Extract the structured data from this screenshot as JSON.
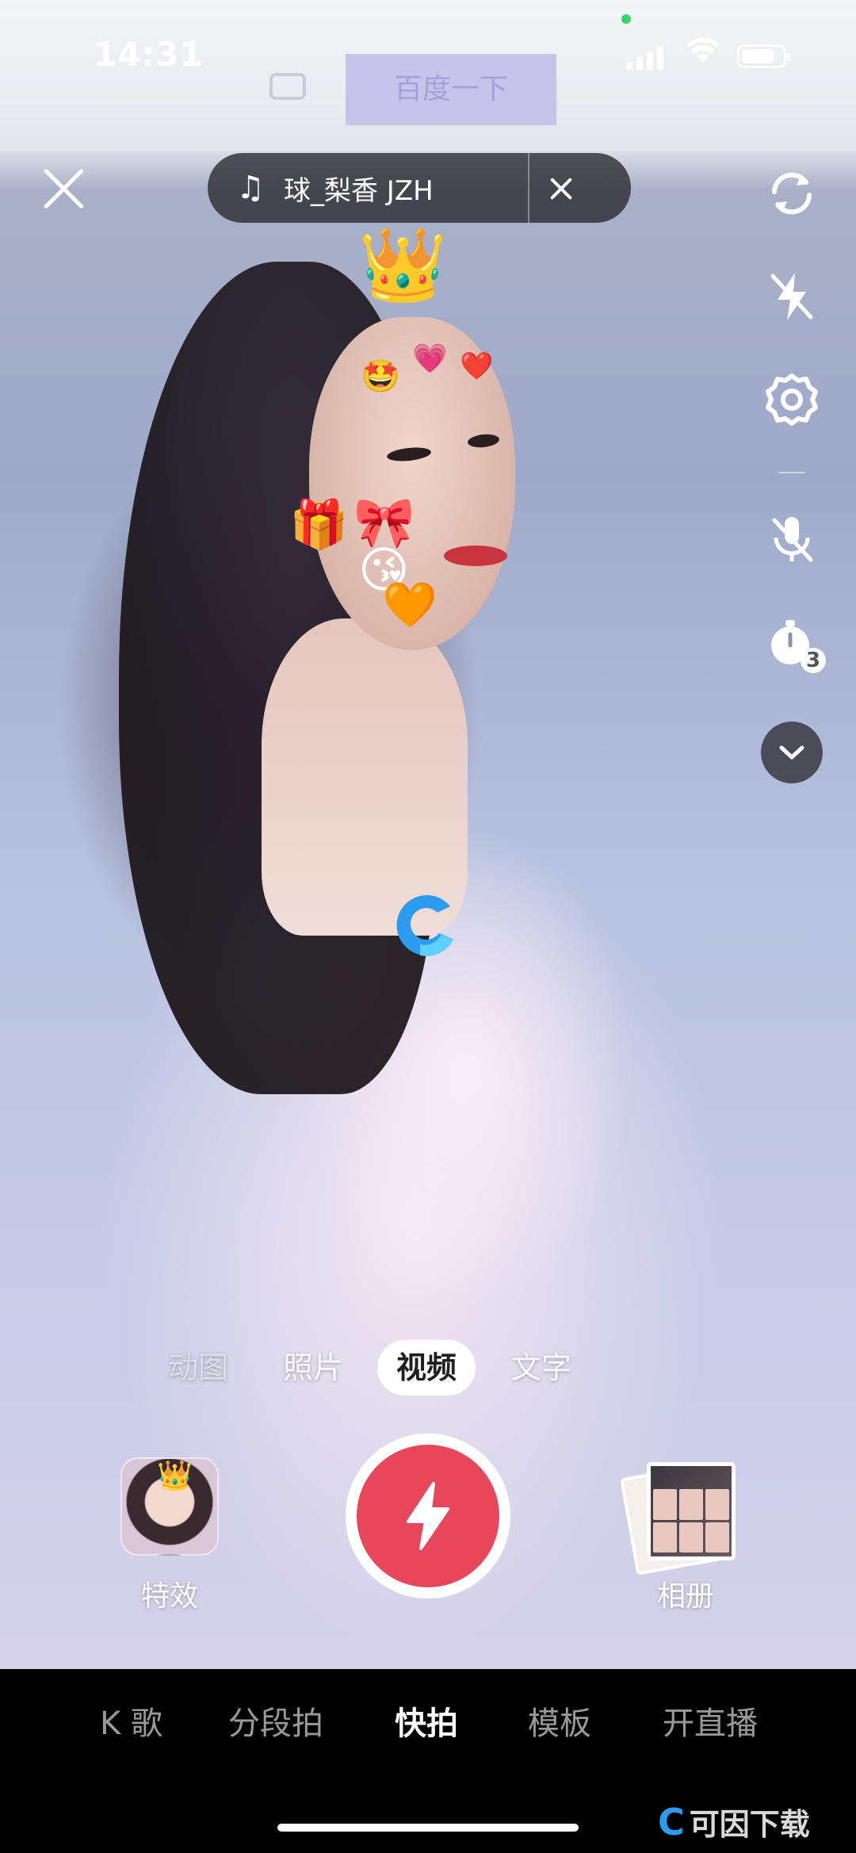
{
  "status_bar": {
    "time": "14:31"
  },
  "background_screen": {
    "search_button": "百度一下"
  },
  "music": {
    "title": "球_梨香 JZH"
  },
  "modes": [
    {
      "label": "动图"
    },
    {
      "label": "照片"
    },
    {
      "label": "视频"
    },
    {
      "label": "文字"
    }
  ],
  "active_mode": "视频",
  "capture": {
    "effects_label": "特效",
    "album_label": "相册"
  },
  "bottom_nav": [
    {
      "label": "K 歌"
    },
    {
      "label": "分段拍"
    },
    {
      "label": "快拍"
    },
    {
      "label": "模板"
    },
    {
      "label": "开直播"
    }
  ],
  "active_nav": "快拍",
  "timer_badge": "3",
  "watermark": {
    "text": "可因下载"
  },
  "colors": {
    "shutter": "#e8465b",
    "accent_blue": "#2c9cf0"
  },
  "icons": [
    "close-icon",
    "music-note-icon",
    "flip-camera-icon",
    "flash-off-icon",
    "settings-icon",
    "mic-off-icon",
    "timer-icon",
    "chevron-down-icon",
    "lightning-icon"
  ]
}
